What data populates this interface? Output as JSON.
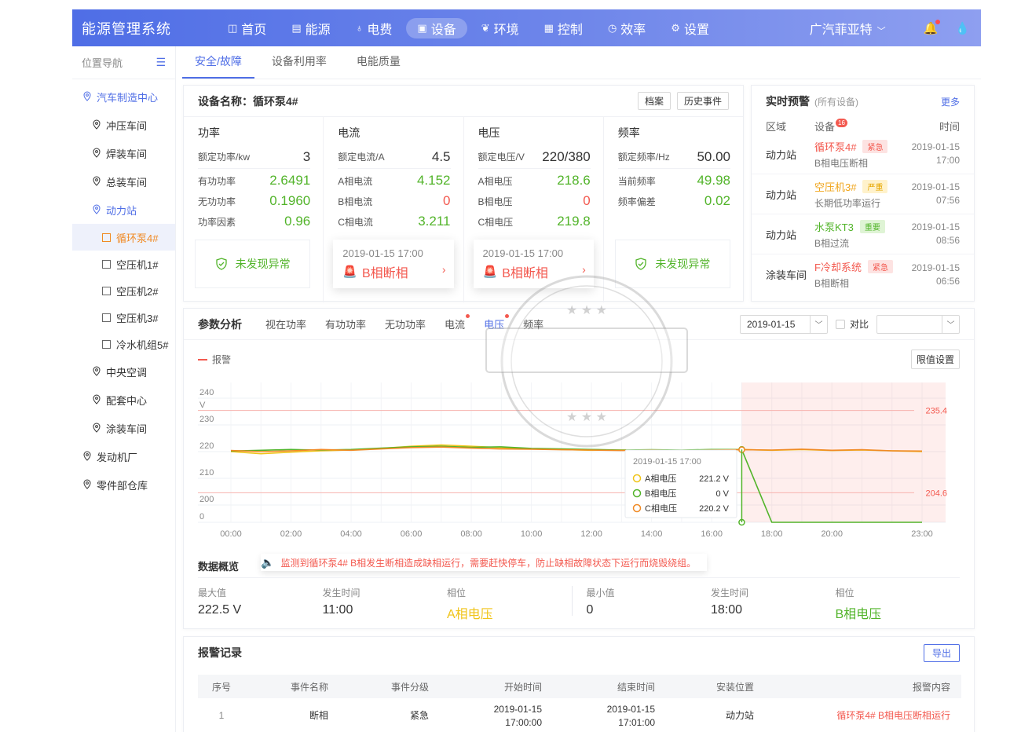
{
  "app": {
    "title": "能源管理系统",
    "company": "广汽菲亚特"
  },
  "nav": [
    {
      "label": "首页",
      "icon": "chart-icon"
    },
    {
      "label": "能源",
      "icon": "document-icon"
    },
    {
      "label": "电费",
      "icon": "bulb-icon"
    },
    {
      "label": "设备",
      "icon": "device-icon"
    },
    {
      "label": "环境",
      "icon": "leaf-icon"
    },
    {
      "label": "控制",
      "icon": "control-icon"
    },
    {
      "label": "效率",
      "icon": "clock-icon"
    },
    {
      "label": "设置",
      "icon": "gear-icon"
    }
  ],
  "sidebar": {
    "title": "位置导航",
    "items": [
      "汽车制造中心",
      "冲压车间",
      "焊装车间",
      "总装车间",
      "动力站",
      "循环泵4#",
      "空压机1#",
      "空压机2#",
      "空压机3#",
      "冷水机组5#",
      "中央空调",
      "配套中心",
      "涂装车间",
      "发动机厂",
      "零件部仓库"
    ]
  },
  "tabs": [
    "安全/故障",
    "设备利用率",
    "电能质量"
  ],
  "device": {
    "title": "设备名称：循环泵4#",
    "btn_archive": "档案",
    "btn_history": "历史事件",
    "power": {
      "title": "功率",
      "rated_label": "额定功率/kw",
      "rated": "3",
      "rows": [
        [
          "有功功率",
          "2.6491"
        ],
        [
          "无功功率",
          "0.1960"
        ],
        [
          "功率因素",
          "0.96"
        ]
      ],
      "status": "未发现异常"
    },
    "current": {
      "title": "电流",
      "rated_label": "额定电流/A",
      "rated": "4.5",
      "rows": [
        [
          "A相电流",
          "4.152"
        ],
        [
          "B相电流",
          "0"
        ],
        [
          "C相电流",
          "3.211"
        ]
      ],
      "fault_time": "2019-01-15 17:00",
      "fault": "B相断相"
    },
    "voltage": {
      "title": "电压",
      "rated_label": "额定电压/V",
      "rated": "220/380",
      "rows": [
        [
          "A相电压",
          "218.6"
        ],
        [
          "B相电压",
          "0"
        ],
        [
          "C相电压",
          "219.8"
        ]
      ],
      "fault_time": "2019-01-15 17:00",
      "fault": "B相断相"
    },
    "freq": {
      "title": "频率",
      "rated_label": "额定频率/Hz",
      "rated": "50.00",
      "rows": [
        [
          "当前频率",
          "49.98"
        ],
        [
          "频率偏差",
          "0.02"
        ]
      ],
      "status": "未发现异常"
    }
  },
  "alerts": {
    "title": "实时预警",
    "subtitle": "(所有设备)",
    "more": "更多",
    "col_area": "区域",
    "col_device": "设备",
    "badge": "16",
    "col_time": "时间",
    "rows": [
      {
        "area": "动力站",
        "name": "循环泵4#",
        "tag": "紧急",
        "desc": "B相电压断相",
        "date": "2019-01-15",
        "time": "17:00"
      },
      {
        "area": "动力站",
        "name": "空压机3#",
        "tag": "严重",
        "desc": "长期低功率运行",
        "date": "2019-01-15",
        "time": "07:56"
      },
      {
        "area": "动力站",
        "name": "水泵KT3",
        "tag": "重要",
        "desc": "B相过流",
        "date": "2019-01-15",
        "time": "08:56"
      },
      {
        "area": "涂装车间",
        "name": "F冷却系统",
        "tag": "紧急",
        "desc": "B相断相",
        "date": "2019-01-15",
        "time": "06:56"
      }
    ]
  },
  "analysis": {
    "title": "参数分析",
    "tabs": [
      "视在功率",
      "有功功率",
      "无功功率",
      "电流",
      "电压",
      "频率"
    ],
    "date": "2019-01-15",
    "compare": "对比",
    "legend_alarm": "报警",
    "limit_btn": "限值设置",
    "overview": "数据概览",
    "notice": "监测到循环泵4# B相发生断相造成缺相运行，需要赶快停车，防止缺相故障状态下运行而烧毁绕组。",
    "stats": {
      "max_label": "最大值",
      "max": "222.5 V",
      "max_time_label": "发生时间",
      "max_time": "11:00",
      "max_phase_label": "相位",
      "max_phase": "A相电压",
      "min_label": "最小值",
      "min": "0",
      "min_time_label": "发生时间",
      "min_time": "18:00",
      "min_phase_label": "相位",
      "min_phase": "B相电压"
    }
  },
  "chart_data": {
    "type": "line",
    "ylabel": "V",
    "yticks": [
      "240",
      "230",
      "220",
      "210",
      "200",
      "0"
    ],
    "xticks": [
      "00:00",
      "02:00",
      "04:00",
      "06:00",
      "08:00",
      "10:00",
      "12:00",
      "14:00",
      "16:00",
      "18:00",
      "20:00",
      "23:00"
    ],
    "limits": {
      "upper": "235.4",
      "lower": "204.6"
    },
    "alarm_start": 17,
    "series": [
      {
        "name": "A相电压",
        "color": "#f0c419",
        "values": [
          220.0,
          219.2,
          219.8,
          220.3,
          220.6,
          221.2,
          222.0,
          222.5,
          222.0,
          221.5,
          221.0,
          220.8,
          220.5,
          220.6,
          220.3,
          220.5,
          220.7,
          220.8,
          220.5,
          220.8,
          220.4,
          220.6,
          220.3,
          220.0
        ]
      },
      {
        "name": "B相电压",
        "color": "#52b42a",
        "values": [
          220.2,
          220.5,
          220.8,
          220.6,
          220.8,
          221.3,
          221.8,
          222.0,
          221.6,
          221.8,
          221.2,
          221.0,
          220.8,
          220.6,
          220.7,
          220.6,
          220.8,
          220.8,
          0,
          0,
          0,
          0,
          0,
          0
        ]
      },
      {
        "name": "C相电压",
        "color": "#f08a24",
        "values": [
          220.4,
          220.0,
          220.3,
          220.8,
          220.5,
          221.0,
          221.5,
          221.7,
          221.3,
          221.0,
          220.9,
          220.7,
          220.6,
          220.4,
          220.6,
          220.4,
          220.6,
          220.7,
          220.6,
          220.9,
          220.5,
          220.7,
          220.3,
          220.2
        ]
      }
    ],
    "tooltip": {
      "time": "2019-01-15 17:00",
      "rows": [
        {
          "name": "A相电压",
          "value": "221.2 V"
        },
        {
          "name": "B相电压",
          "value": "0 V"
        },
        {
          "name": "C相电压",
          "value": "220.2 V"
        }
      ]
    },
    "grid": true
  },
  "records": {
    "title": "报警记录",
    "export": "导出",
    "columns": [
      "序号",
      "事件名称",
      "事件分级",
      "开始时间",
      "结束时间",
      "安装位置",
      "报警内容"
    ],
    "rows": [
      {
        "no": "1",
        "event": "断相",
        "level": "紧急",
        "start_date": "2019-01-15",
        "start_time": "17:00:00",
        "end_date": "2019-01-15",
        "end_time": "17:01:00",
        "location": "动力站",
        "content": "循环泵4#  B相电压断相运行"
      }
    ]
  }
}
